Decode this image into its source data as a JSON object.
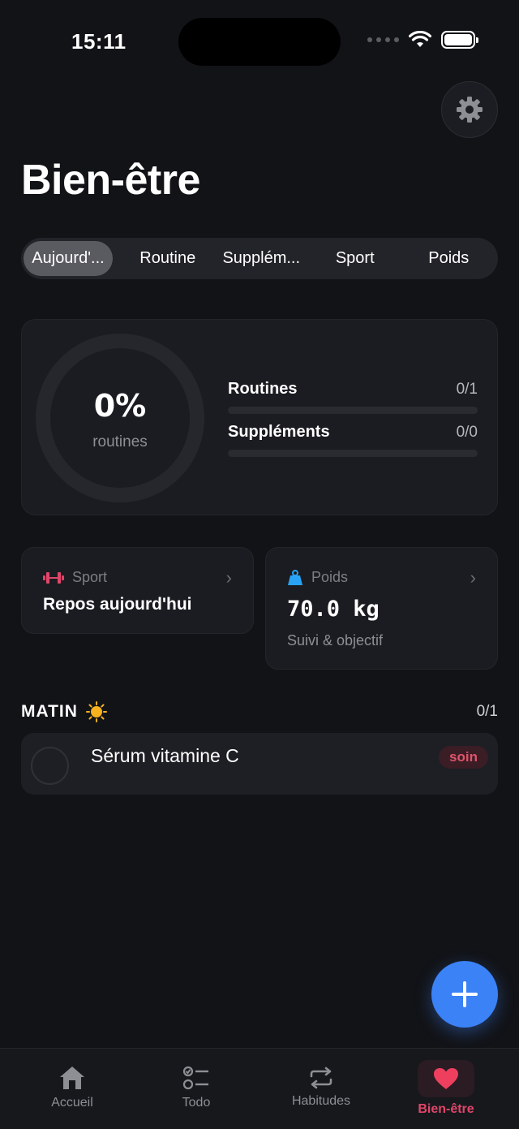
{
  "status_bar": {
    "time": "15:11"
  },
  "header": {
    "title": "Bien-être"
  },
  "tabs": [
    {
      "label": "Aujourd'...",
      "active": true
    },
    {
      "label": "Routine",
      "active": false
    },
    {
      "label": "Supplém...",
      "active": false
    },
    {
      "label": "Sport",
      "active": false
    },
    {
      "label": "Poids",
      "active": false
    }
  ],
  "progress": {
    "percent_label": "0%",
    "percent_value": 0,
    "ring_label": "routines",
    "bars": [
      {
        "name": "Routines",
        "count": "0/1",
        "fraction": 0
      },
      {
        "name": "Suppléments",
        "count": "0/0",
        "fraction": 0
      }
    ]
  },
  "sport_card": {
    "label": "Sport",
    "value": "Repos aujourd'hui",
    "icon": "dumbbell-icon"
  },
  "poids_card": {
    "label": "Poids",
    "value": "70.0 kg",
    "subtitle": "Suivi & objectif",
    "icon": "weight-icon"
  },
  "section": {
    "title": "MATIN",
    "count": "0/1",
    "icon": "sun-icon"
  },
  "routine_items": [
    {
      "name": "Sérum vitamine C",
      "tag": "soin",
      "done": false
    }
  ],
  "bottom_nav": [
    {
      "label": "Accueil",
      "icon": "home-icon",
      "active": false
    },
    {
      "label": "Todo",
      "icon": "checklist-icon",
      "active": false
    },
    {
      "label": "Habitudes",
      "icon": "repeat-icon",
      "active": false
    },
    {
      "label": "Bien-être",
      "icon": "heart-icon",
      "active": true
    }
  ],
  "colors": {
    "background": "#121317",
    "accent_blue": "#3b82f6",
    "accent_pink": "#e0466a",
    "tag_text": "#e0546b"
  }
}
